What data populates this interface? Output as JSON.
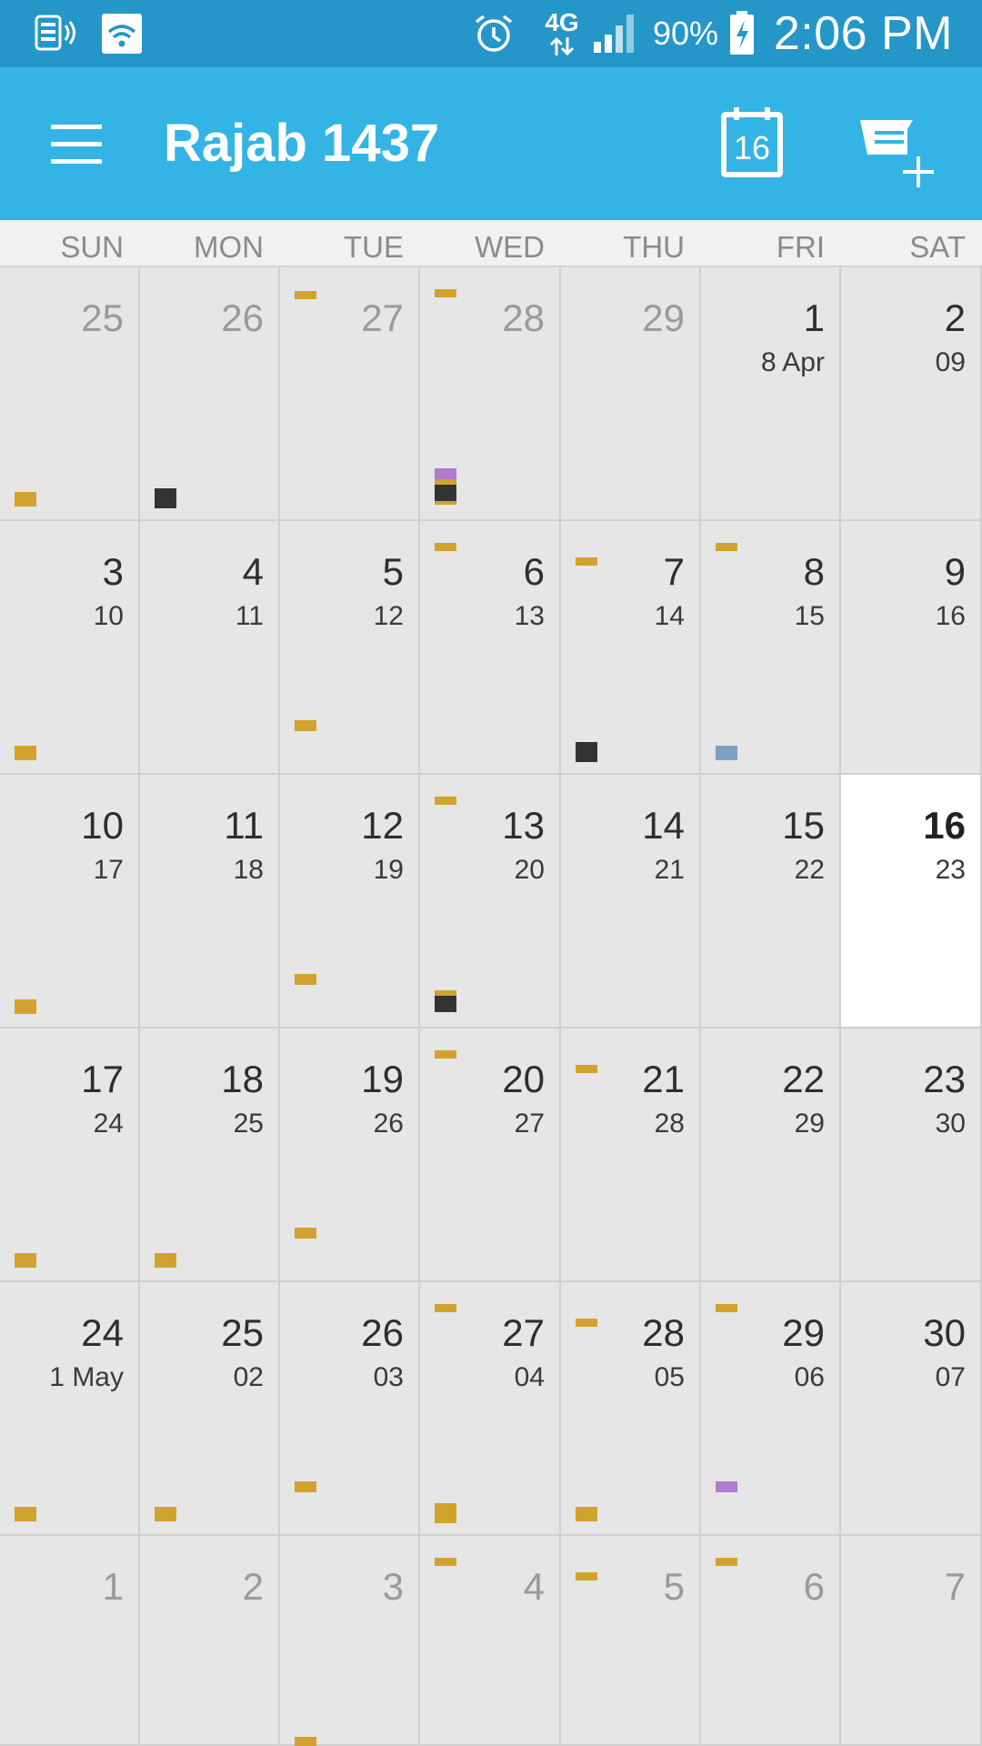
{
  "status_bar": {
    "time": "2:06 PM",
    "battery": "90%",
    "network": "4G",
    "icons": [
      "voicemail-icon",
      "wifi-icon",
      "alarm-icon",
      "network-4g-icon",
      "signal-icon",
      "battery-charging-icon"
    ]
  },
  "app_bar": {
    "title": "Rajab 1437",
    "today_icon_day": "16",
    "icons": [
      "menu-icon",
      "calendar-today-icon",
      "add-event-icon"
    ]
  },
  "weekdays": [
    "SUN",
    "MON",
    "TUE",
    "WED",
    "THU",
    "FRI",
    "SAT"
  ],
  "colors": {
    "status_bar": "#2596c8",
    "app_bar": "#33b4e5",
    "event_gold": "#d1a32e",
    "event_dark": "#333333",
    "event_purple": "#b07bd0",
    "event_blue": "#7da1c3"
  },
  "weeks": [
    [
      {
        "day": "25",
        "greg": "",
        "other": true,
        "markers": [
          {
            "pos": "bl",
            "color": "gold"
          }
        ]
      },
      {
        "day": "26",
        "greg": "",
        "other": true,
        "markers": [
          {
            "pos": "bl",
            "color": "dark"
          }
        ]
      },
      {
        "day": "27",
        "greg": "",
        "other": true,
        "markers": [
          {
            "pos": "tl",
            "color": "gold"
          }
        ]
      },
      {
        "day": "28",
        "greg": "",
        "other": true,
        "markers": [
          {
            "pos": "tl",
            "color": "gold"
          },
          {
            "pos": "bl",
            "color": "stack-purple"
          }
        ]
      },
      {
        "day": "29",
        "greg": "",
        "other": true,
        "markers": []
      },
      {
        "day": "1",
        "greg": "8 Apr",
        "other": false,
        "markers": []
      },
      {
        "day": "2",
        "greg": "09",
        "other": false,
        "markers": []
      }
    ],
    [
      {
        "day": "3",
        "greg": "10",
        "other": false,
        "markers": [
          {
            "pos": "bl",
            "color": "gold"
          }
        ]
      },
      {
        "day": "4",
        "greg": "11",
        "other": false,
        "markers": []
      },
      {
        "day": "5",
        "greg": "12",
        "other": false,
        "markers": [
          {
            "pos": "bl-mid",
            "color": "gold"
          }
        ]
      },
      {
        "day": "6",
        "greg": "13",
        "other": false,
        "markers": [
          {
            "pos": "tl",
            "color": "gold"
          }
        ]
      },
      {
        "day": "7",
        "greg": "14",
        "other": false,
        "markers": [
          {
            "pos": "tl",
            "color": "gold"
          },
          {
            "pos": "bl",
            "color": "dark"
          }
        ]
      },
      {
        "day": "8",
        "greg": "15",
        "other": false,
        "markers": [
          {
            "pos": "tl",
            "color": "gold"
          },
          {
            "pos": "bl",
            "color": "blue"
          }
        ]
      },
      {
        "day": "9",
        "greg": "16",
        "other": false,
        "markers": []
      }
    ],
    [
      {
        "day": "10",
        "greg": "17",
        "other": false,
        "markers": [
          {
            "pos": "bl",
            "color": "gold"
          }
        ]
      },
      {
        "day": "11",
        "greg": "18",
        "other": false,
        "markers": []
      },
      {
        "day": "12",
        "greg": "19",
        "other": false,
        "markers": [
          {
            "pos": "bl-mid",
            "color": "gold"
          }
        ]
      },
      {
        "day": "13",
        "greg": "20",
        "other": false,
        "markers": [
          {
            "pos": "tl",
            "color": "gold"
          },
          {
            "pos": "bl",
            "color": "stack-dark"
          }
        ]
      },
      {
        "day": "14",
        "greg": "21",
        "other": false,
        "markers": []
      },
      {
        "day": "15",
        "greg": "22",
        "other": false,
        "markers": []
      },
      {
        "day": "16",
        "greg": "23",
        "other": false,
        "today": true,
        "markers": []
      }
    ],
    [
      {
        "day": "17",
        "greg": "24",
        "other": false,
        "markers": [
          {
            "pos": "bl",
            "color": "gold"
          }
        ]
      },
      {
        "day": "18",
        "greg": "25",
        "other": false,
        "markers": [
          {
            "pos": "bl",
            "color": "gold"
          }
        ]
      },
      {
        "day": "19",
        "greg": "26",
        "other": false,
        "markers": [
          {
            "pos": "bl-mid",
            "color": "gold"
          }
        ]
      },
      {
        "day": "20",
        "greg": "27",
        "other": false,
        "markers": [
          {
            "pos": "tl",
            "color": "gold"
          }
        ]
      },
      {
        "day": "21",
        "greg": "28",
        "other": false,
        "markers": [
          {
            "pos": "tl",
            "color": "gold"
          }
        ]
      },
      {
        "day": "22",
        "greg": "29",
        "other": false,
        "markers": []
      },
      {
        "day": "23",
        "greg": "30",
        "other": false,
        "markers": []
      }
    ],
    [
      {
        "day": "24",
        "greg": "1 May",
        "other": false,
        "markers": [
          {
            "pos": "bl",
            "color": "gold"
          }
        ]
      },
      {
        "day": "25",
        "greg": "02",
        "other": false,
        "markers": [
          {
            "pos": "bl",
            "color": "gold"
          }
        ]
      },
      {
        "day": "26",
        "greg": "03",
        "other": false,
        "markers": [
          {
            "pos": "bl-mid",
            "color": "gold"
          }
        ]
      },
      {
        "day": "27",
        "greg": "04",
        "other": false,
        "markers": [
          {
            "pos": "tl",
            "color": "gold"
          },
          {
            "pos": "bl",
            "color": "stack-gold"
          }
        ]
      },
      {
        "day": "28",
        "greg": "05",
        "other": false,
        "markers": [
          {
            "pos": "tl",
            "color": "gold"
          },
          {
            "pos": "bl",
            "color": "gold"
          }
        ]
      },
      {
        "day": "29",
        "greg": "06",
        "other": false,
        "markers": [
          {
            "pos": "tl",
            "color": "gold"
          },
          {
            "pos": "bl-mid",
            "color": "purple"
          }
        ]
      },
      {
        "day": "30",
        "greg": "07",
        "other": false,
        "markers": []
      }
    ],
    [
      {
        "day": "1",
        "greg": "",
        "other": true,
        "markers": []
      },
      {
        "day": "2",
        "greg": "",
        "other": true,
        "markers": []
      },
      {
        "day": "3",
        "greg": "",
        "other": true,
        "markers": [
          {
            "pos": "bottom",
            "color": "gold"
          }
        ]
      },
      {
        "day": "4",
        "greg": "",
        "other": true,
        "markers": [
          {
            "pos": "tl",
            "color": "gold"
          }
        ]
      },
      {
        "day": "5",
        "greg": "",
        "other": true,
        "markers": [
          {
            "pos": "tl",
            "color": "gold"
          }
        ]
      },
      {
        "day": "6",
        "greg": "",
        "other": true,
        "markers": [
          {
            "pos": "tl",
            "color": "gold"
          }
        ]
      },
      {
        "day": "7",
        "greg": "",
        "other": true,
        "markers": []
      }
    ]
  ]
}
